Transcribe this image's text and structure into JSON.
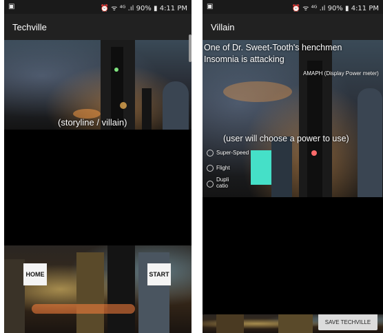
{
  "statusbar": {
    "left_icon": "gallery-icon",
    "indicators": "⏰ ᯤ ⁴ᴳ .ıl",
    "battery": "90%",
    "time": "4:11 PM"
  },
  "left_screen": {
    "title": "Techville",
    "placeholder_text": "(storyline / villain)",
    "home_button": "HOME",
    "start_button": "START"
  },
  "right_screen": {
    "title": "Villain",
    "villain_line_1": "One of Dr. Sweet-Tooth's henchmen",
    "villain_line_2": "Insomnia is attacking",
    "power_meter_label": "AMAPH (Display Power meter)",
    "choose_text": "(user will choose a power to use)",
    "powers": [
      {
        "label": "Super-Speed"
      },
      {
        "label": "Flight"
      },
      {
        "label": "Dupli catio"
      }
    ],
    "save_button": "SAVE TECHVILLE"
  },
  "colors": {
    "statusbar_bg": "#1a1a1a",
    "appbar_bg": "#212121",
    "content_bg": "#000000",
    "button_bg": "#f4f4f4"
  }
}
